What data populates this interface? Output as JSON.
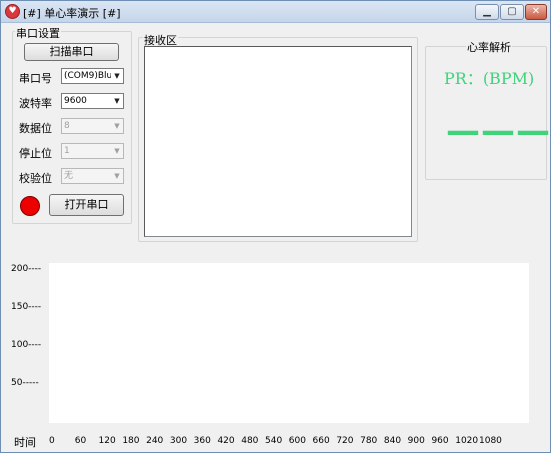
{
  "window": {
    "title": "[#] 单心率演示 [#]",
    "icon": "heart-icon",
    "min_glyph": "▁",
    "max_glyph": "▢",
    "close_glyph": "✕"
  },
  "serial": {
    "legend": "串口设置",
    "scan_button": "扫描串口",
    "port_label": "串口号",
    "port_value": "(COM9)Blu",
    "baud_label": "波特率",
    "baud_value": "9600",
    "databits_label": "数据位",
    "databits_value": "8",
    "stopbits_label": "停止位",
    "stopbits_value": "1",
    "parity_label": "校验位",
    "parity_value": "无",
    "status_color": "#ee0000",
    "open_button": "打开串口"
  },
  "receive": {
    "legend": "接收区",
    "content": ""
  },
  "heart_rate": {
    "legend": "心率解析",
    "pr_label": "PR：(BPM)",
    "value": "———",
    "color": "#3fd37a"
  },
  "chart_data": {
    "type": "line",
    "series": [],
    "yticks": [
      "200----",
      "150----",
      "100----",
      "50-----"
    ],
    "xlabel": "时间",
    "xticks": [
      "0",
      "60",
      "120",
      "180",
      "240",
      "300",
      "360",
      "420",
      "480",
      "540",
      "600",
      "660",
      "720",
      "780",
      "840",
      "900",
      "960",
      "1020",
      "1080"
    ]
  }
}
